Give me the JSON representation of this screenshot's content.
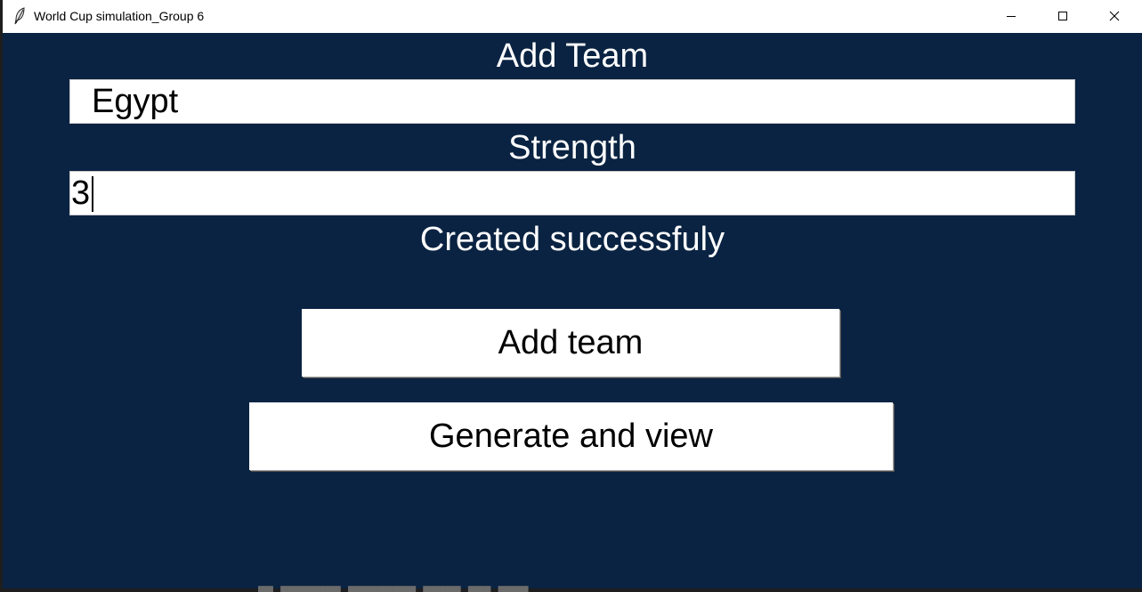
{
  "window": {
    "title": "World Cup simulation_Group 6",
    "icon": "feather-icon",
    "controls": [
      "minimize-icon",
      "maximize-icon",
      "close-icon"
    ]
  },
  "form": {
    "team_label": "Add Team",
    "team_value": "Egypt",
    "strength_label": "Strength",
    "strength_value": "3",
    "status_text": "Created successfuly"
  },
  "buttons": {
    "add_team": "Add team",
    "generate": "Generate and view"
  },
  "colors": {
    "background": "#0a2342",
    "text": "#ffffff",
    "field": "#ffffff"
  }
}
